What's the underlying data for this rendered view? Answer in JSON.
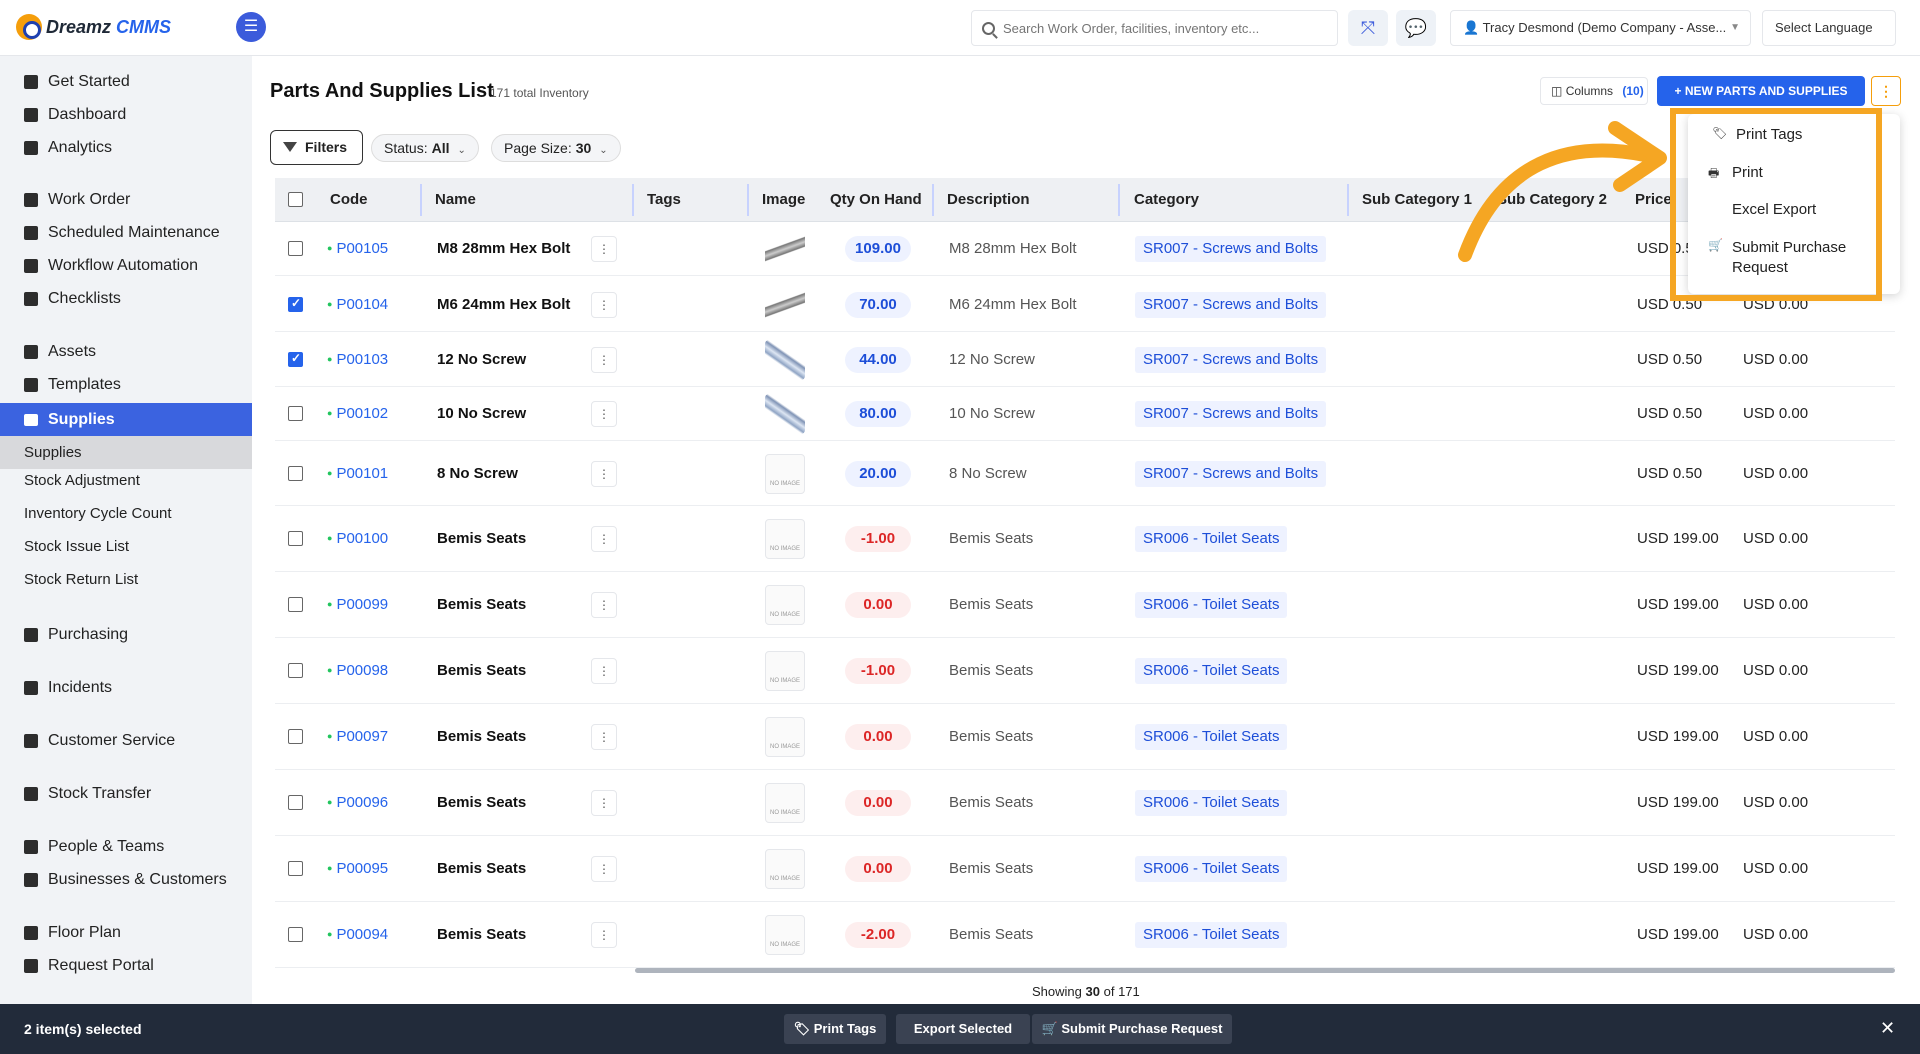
{
  "app": {
    "logo_main": "Dreamz",
    "logo_accent": "CMMS"
  },
  "header": {
    "search_placeholder": "Search Work Order, facilities, inventory etc...",
    "user": "Tracy Desmond (Demo Company - Asse...",
    "language": "Select Language"
  },
  "sidebar": {
    "items": [
      {
        "label": "Get Started"
      },
      {
        "label": "Dashboard"
      },
      {
        "label": "Analytics"
      },
      {
        "label": "Work Order"
      },
      {
        "label": "Scheduled Maintenance"
      },
      {
        "label": "Workflow Automation"
      },
      {
        "label": "Checklists"
      },
      {
        "label": "Assets"
      },
      {
        "label": "Templates"
      },
      {
        "label": "Supplies"
      },
      {
        "label": "Supplies"
      },
      {
        "label": "Stock Adjustment"
      },
      {
        "label": "Inventory Cycle Count"
      },
      {
        "label": "Stock Issue List"
      },
      {
        "label": "Stock Return List"
      },
      {
        "label": "Purchasing"
      },
      {
        "label": "Incidents"
      },
      {
        "label": "Customer Service"
      },
      {
        "label": "Stock Transfer"
      },
      {
        "label": "People & Teams"
      },
      {
        "label": "Businesses & Customers"
      },
      {
        "label": "Floor Plan"
      },
      {
        "label": "Request Portal"
      }
    ]
  },
  "page": {
    "title": "Parts And Supplies List",
    "count": "171 total Inventory",
    "columns_label": "Columns",
    "columns_count": "(10)",
    "new_button": "+ NEW PARTS AND SUPPLIES",
    "filters_label": "Filters",
    "status_label": "Status:",
    "status_value": "All",
    "pagesize_label": "Page Size:",
    "pagesize_value": "30"
  },
  "table": {
    "headers": [
      "Code",
      "Name",
      "Tags",
      "Image",
      "Qty On Hand",
      "Description",
      "Category",
      "Sub Category 1",
      "Sub Category 2",
      "Price"
    ],
    "rows": [
      {
        "checked": false,
        "code": "P00105",
        "name": "M8 28mm Hex Bolt",
        "image": "bolt",
        "qty": "109.00",
        "desc": "M8 28mm Hex Bolt",
        "category": "SR007 - Screws and Bolts",
        "price": "USD 0.50",
        "price2": ""
      },
      {
        "checked": true,
        "code": "P00104",
        "name": "M6 24mm Hex Bolt",
        "image": "bolt",
        "qty": "70.00",
        "desc": "M6 24mm Hex Bolt",
        "category": "SR007 - Screws and Bolts",
        "price": "USD 0.50",
        "price2": "USD 0.00"
      },
      {
        "checked": true,
        "code": "P00103",
        "name": "12 No Screw",
        "image": "screw",
        "qty": "44.00",
        "desc": "12 No Screw",
        "category": "SR007 - Screws and Bolts",
        "price": "USD 0.50",
        "price2": "USD 0.00"
      },
      {
        "checked": false,
        "code": "P00102",
        "name": "10 No Screw",
        "image": "screw",
        "qty": "80.00",
        "desc": "10 No Screw",
        "category": "SR007 - Screws and Bolts",
        "price": "USD 0.50",
        "price2": "USD 0.00"
      },
      {
        "checked": false,
        "code": "P00101",
        "name": "8 No Screw",
        "image": "noimg",
        "qty": "20.00",
        "desc": "8 No Screw",
        "category": "SR007 - Screws and Bolts",
        "price": "USD 0.50",
        "price2": "USD 0.00"
      },
      {
        "checked": false,
        "code": "P00100",
        "name": "Bemis Seats",
        "image": "noimg",
        "qty": "-1.00",
        "desc": "Bemis Seats",
        "category": "SR006 - Toilet Seats",
        "price": "USD 199.00",
        "price2": "USD 0.00"
      },
      {
        "checked": false,
        "code": "P00099",
        "name": "Bemis Seats",
        "image": "noimg",
        "qty": "0.00",
        "desc": "Bemis Seats",
        "category": "SR006 - Toilet Seats",
        "price": "USD 199.00",
        "price2": "USD 0.00"
      },
      {
        "checked": false,
        "code": "P00098",
        "name": "Bemis Seats",
        "image": "noimg",
        "qty": "-1.00",
        "desc": "Bemis Seats",
        "category": "SR006 - Toilet Seats",
        "price": "USD 199.00",
        "price2": "USD 0.00"
      },
      {
        "checked": false,
        "code": "P00097",
        "name": "Bemis Seats",
        "image": "noimg",
        "qty": "0.00",
        "desc": "Bemis Seats",
        "category": "SR006 - Toilet Seats",
        "price": "USD 199.00",
        "price2": "USD 0.00"
      },
      {
        "checked": false,
        "code": "P00096",
        "name": "Bemis Seats",
        "image": "noimg",
        "qty": "0.00",
        "desc": "Bemis Seats",
        "category": "SR006 - Toilet Seats",
        "price": "USD 199.00",
        "price2": "USD 0.00"
      },
      {
        "checked": false,
        "code": "P00095",
        "name": "Bemis Seats",
        "image": "noimg",
        "qty": "0.00",
        "desc": "Bemis Seats",
        "category": "SR006 - Toilet Seats",
        "price": "USD 199.00",
        "price2": "USD 0.00"
      },
      {
        "checked": false,
        "code": "P00094",
        "name": "Bemis Seats",
        "image": "noimg",
        "qty": "-2.00",
        "desc": "Bemis Seats",
        "category": "SR006 - Toilet Seats",
        "price": "USD 199.00",
        "price2": "USD 0.00"
      }
    ],
    "no_image_text": "NO IMAGE"
  },
  "footer": {
    "showing_prefix": "Showing",
    "showing_count": "30",
    "showing_of": "of",
    "showing_total": "171"
  },
  "dropdown": {
    "items": [
      {
        "label": "Print Tags",
        "icon": "tag-icon"
      },
      {
        "label": "Print",
        "icon": "printer-icon"
      },
      {
        "label": "Excel Export",
        "icon": ""
      },
      {
        "label": "Submit Purchase Request",
        "icon": "cart-icon"
      }
    ]
  },
  "bottombar": {
    "selected": "2 item(s) selected",
    "print_tags": "Print Tags",
    "export_selected": "Export Selected",
    "submit_purchase": "Submit Purchase Request"
  },
  "colors": {
    "accent": "#2563eb",
    "highlight": "#f5a623",
    "positive": "#1d4ed8",
    "negative": "#dc2626"
  }
}
